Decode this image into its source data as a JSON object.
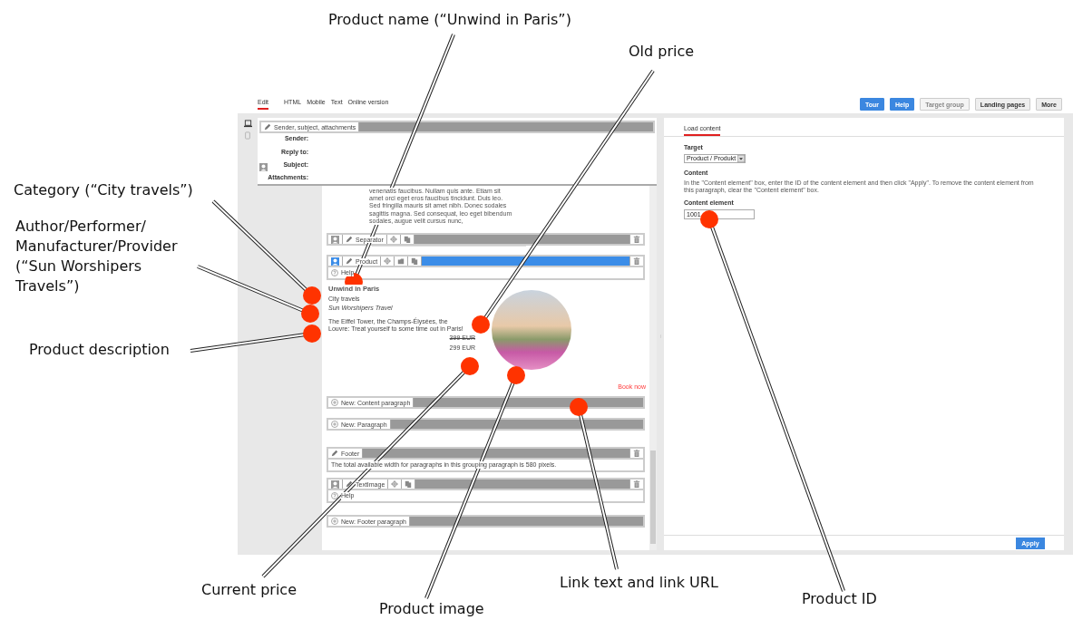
{
  "callouts": [
    {
      "text": "Product name (“Unwind in Paris”)"
    },
    {
      "text": "Old price"
    },
    {
      "text": "Category (“City travels”)"
    },
    {
      "text": "Author/Performer/\nManufacturer/Provider\n(“Sun Worshipers\nTravels”)"
    },
    {
      "text": "Product description"
    },
    {
      "text": "Current price"
    },
    {
      "text": "Product image"
    },
    {
      "text": "Link text and link URL"
    },
    {
      "text": "Product ID"
    }
  ],
  "view_tabs": [
    {
      "label": "Edit",
      "selected": true
    },
    {
      "label": "HTML",
      "selected": false
    },
    {
      "label": "Mobile",
      "selected": false
    },
    {
      "label": "Text",
      "selected": false
    },
    {
      "label": "Online version",
      "selected": false
    }
  ],
  "top_buttons": [
    {
      "label": "Tour",
      "kind": "primary",
      "disabled": false
    },
    {
      "label": "Help",
      "kind": "primary",
      "disabled": false
    },
    {
      "label": "Target group",
      "kind": "default",
      "disabled": true
    },
    {
      "label": "Landing pages",
      "kind": "default",
      "disabled": false
    },
    {
      "label": "More",
      "kind": "default",
      "disabled": false
    }
  ],
  "header": {
    "tab": "Sender, subject, attachments",
    "fields": [
      "Sender:",
      "Reply to:",
      "Subject:",
      "Attachments:"
    ]
  },
  "blocks": [
    {
      "kind": "text",
      "text": "venenatis faucibus. Nullam quis ante. Etiam sit amet orci eget eros faucibus tincidunt. Duis leo. Sed fringilla mauris sit amet nibh. Donec sodales sagittis magna. Sed consequat, leo eget bibendum sodales, augue velit cursus nunc,"
    },
    {
      "kind": "element",
      "label": "Separator",
      "selected": false
    },
    {
      "kind": "rule"
    },
    {
      "kind": "product",
      "label": "Product",
      "selected": true,
      "help": "Help"
    },
    {
      "kind": "product_content",
      "name": "Unwind in Paris",
      "category": "City travels",
      "author": "Sun Worshipers Travel",
      "description": "The Eiffel Tower, the Champs-Élysées, the Louvre: Treat yourself to some time out in Paris!",
      "old_price": "399 EUR",
      "current_price": "299 EUR",
      "link": "Book now"
    },
    {
      "kind": "new",
      "label": "New: Content paragraph"
    },
    {
      "kind": "new",
      "label": "New: Paragraph"
    },
    {
      "kind": "footer",
      "label": "Footer",
      "note": "The total available width for paragraphs in this grouping paragraph is 580 pixels."
    },
    {
      "kind": "element",
      "label": "TextImage",
      "selected": false,
      "help": "Help"
    },
    {
      "kind": "new",
      "label": "New: Footer paragraph"
    }
  ],
  "right_panel": {
    "tab": {
      "label": "Load content",
      "selected": true
    },
    "target_label": "Target",
    "target_value": "Product / Produkt",
    "content_label": "Content",
    "content_help": "In the \"Content element\" box, enter the ID of the content element and then click \"Apply\". To remove the content element from this paragraph, clear the \"Content element\" box.",
    "element_label": "Content element",
    "element_value": "1001",
    "apply": "Apply"
  }
}
